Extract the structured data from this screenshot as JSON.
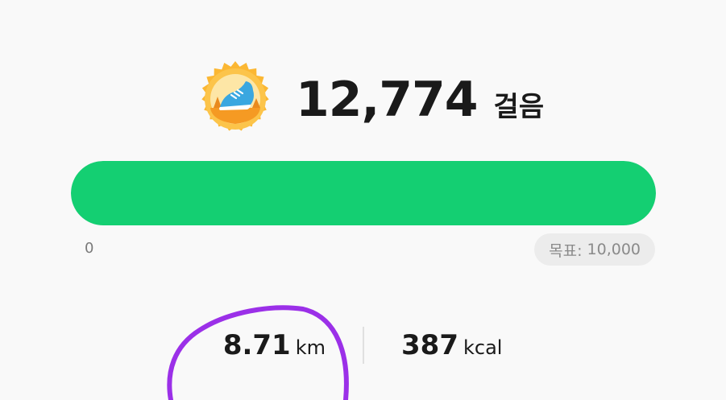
{
  "summary": {
    "steps_value": "12,774",
    "steps_unit": "걸음"
  },
  "progress": {
    "fraction": 1.0,
    "min_label": "0",
    "goal_label": "목표:",
    "goal_value": "10,000",
    "color": "#14cf72"
  },
  "stats": {
    "distance_value": "8.71",
    "distance_unit": "km",
    "calories_value": "387",
    "calories_unit": "kcal"
  },
  "icons": {
    "badge": "running-shoe-badge-icon"
  },
  "annotation": {
    "color": "#9b30e8"
  }
}
